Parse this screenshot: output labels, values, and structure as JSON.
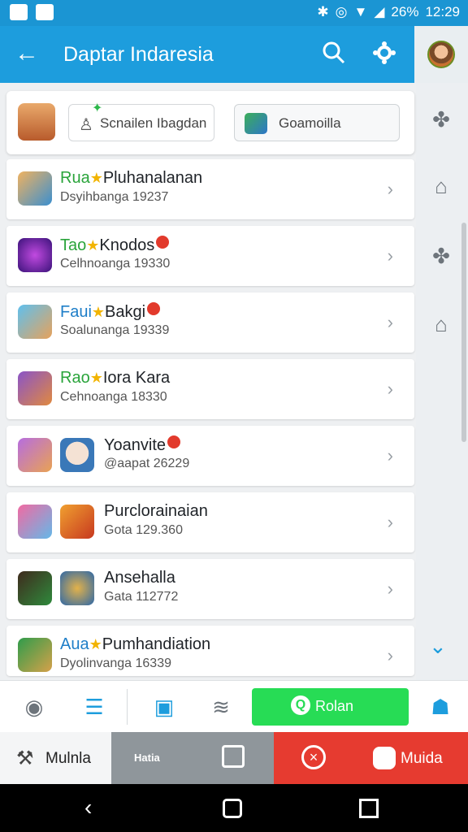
{
  "status": {
    "battery": "26%",
    "time": "12:29"
  },
  "appbar": {
    "title": "Daptar Indaresia"
  },
  "header": {
    "search_chip_label": "Scnailen Ibagdan",
    "other_chip_label": "Goamoilla"
  },
  "list": [
    {
      "prefix": "Rua",
      "name": "Pluhanalanan",
      "sub": "Dsyihbanga 19237",
      "pre_color": "green"
    },
    {
      "prefix": "Tao",
      "name": "Knodos",
      "sub": "Celhnoanga 19330",
      "pre_color": "green"
    },
    {
      "prefix": "Faui",
      "name": "Bakgi",
      "sub": "Soalunanga 19339",
      "pre_color": "blue"
    },
    {
      "prefix": "Rao",
      "name": "Iora Kara",
      "sub": "Cehnoanga 18330",
      "pre_color": "green"
    },
    {
      "prefix": "",
      "name": "Yoanvite",
      "sub": "@aapat 26229",
      "pre_color": "green"
    },
    {
      "prefix": "",
      "name": "Purclorainaian",
      "sub": "Gota 129.360",
      "pre_color": "green"
    },
    {
      "prefix": "",
      "name": "Ansehalla",
      "sub": "Gata 112772",
      "pre_color": "green"
    },
    {
      "prefix": "Aua",
      "name": "Pumhandiation",
      "sub": "Dyolinvanga 16339",
      "pre_color": "blue"
    }
  ],
  "bottombar": {
    "action_label": "Rolan"
  },
  "tabs": {
    "left_label": "Mulnla",
    "center_label": "Hatia",
    "right_label": "Muida"
  },
  "colors": {
    "brand": "#1d9ddd",
    "accent_green": "#27dc55",
    "danger": "#e63b30"
  }
}
